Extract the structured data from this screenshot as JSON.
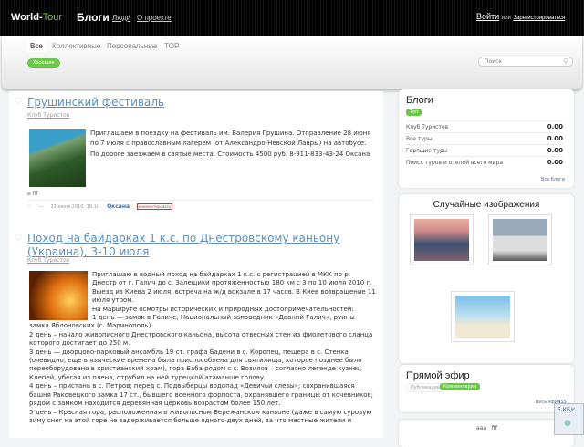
{
  "header": {
    "logo_a": "World-",
    "logo_b": "Tour",
    "title": "Блоги",
    "links": [
      "Люди",
      "О проекте"
    ],
    "login": "Войти",
    "or": "или",
    "register": "Зарегистрироваться"
  },
  "subnav": {
    "tabs": [
      "Все",
      "Коллективные",
      "Персональные",
      "TOP"
    ],
    "filter": "Хорошие",
    "search_placeholder": "Поиск"
  },
  "posts": [
    {
      "title": "Грушинский фестиваль",
      "club": "Клуб Туристов",
      "text": "Приглашаем в поездку на фестиваль им. Валерия Грушина. Отправление 28 июня по 7 июля с православным лагерем (от Александро-Невской Лавры) на автобусе. По дороге заезжаем в святые места. Стоимость 4500 руб. 8-911-833-43-24 Оксана",
      "tag": "fff",
      "rating": "—",
      "date": "23 июня 2010, 18:10",
      "author": "Оксана",
      "comment": "комментировать"
    },
    {
      "title": "Поход на байдарках 1 к.с. по Днестровскому каньону (Украина), 3-10 июля",
      "club": "Клуб Туристов",
      "paras": [
        "Приглашаю в водный поход на байдарках 1 к.с. с регистрацией в МКК по р. Днестр от г. Галич до с. Залещики протяженностью 180 км с 3 по 10 июля 2010 г. Выезд из Киева 2 июля, встреча на ж/д вокзале в 17 часов. В Киев возвращение 11 июля утром.",
        "На маршруте осмотры исторических и природных достопримечательностей:",
        "1 день — замок в Галиче, Национальный заповедник «Давний Галич», руины замка Яблоновских (с. Маринополь).",
        "2 день – начало живописного Днестровского каньона, высота отвесных стен из фиолетового сланца которого достигает до 250 м.",
        "3 день — дворцово-парковый ансамбль 19 ст. графа Бадени в с. Коропец, пещера в с. Стенка (очевидно, еще в языческие времена была приспособлена для святилища, которое позднее было переоборудовано в христианский храм), гора Баба рядом с с. Возилов – согласно легенде кузнец Клепей, убегая из плена, отрубил на ней турецкой атаманше голову.",
        "4 день – пристань в с. Петров; перед с. Подвыберцы водопад «Девичьи слезы»; сохранившаяся башня Раковецкого замка 17 ст., бывшего военного форпоста, охранявшего границы от кочевников; рядом с замком находится деревянная церковь возрастом более 150 лет.",
        "5 день – Красная гора, расположенная в живописном Бережанском каньоне (даже в самую суровую зиму снег на этой горе не задерживается больше одного-двух дней, за что местные жители и"
      ]
    }
  ],
  "sidebar": {
    "blogs": {
      "title": "Блоги",
      "tab": "Топ",
      "rows": [
        {
          "name": "Клуб Туристов",
          "value": "0.00"
        },
        {
          "name": "Все туры",
          "value": "0.00"
        },
        {
          "name": "Горящие туры",
          "value": "0.00"
        },
        {
          "name": "Поиск туров и отелей всего мира",
          "value": "0.00"
        }
      ],
      "all": "Все блоги"
    },
    "images": {
      "title": "Случайные изображения"
    },
    "live": {
      "title": "Прямой эфир",
      "tabs": [
        "Публикации",
        "Комментарии"
      ],
      "all": "Весь эфир",
      "rss": "RSS"
    },
    "tags": {
      "items": [
        "aaa",
        "fff"
      ]
    }
  },
  "widget": {
    "speed": "5 КБ/с"
  }
}
